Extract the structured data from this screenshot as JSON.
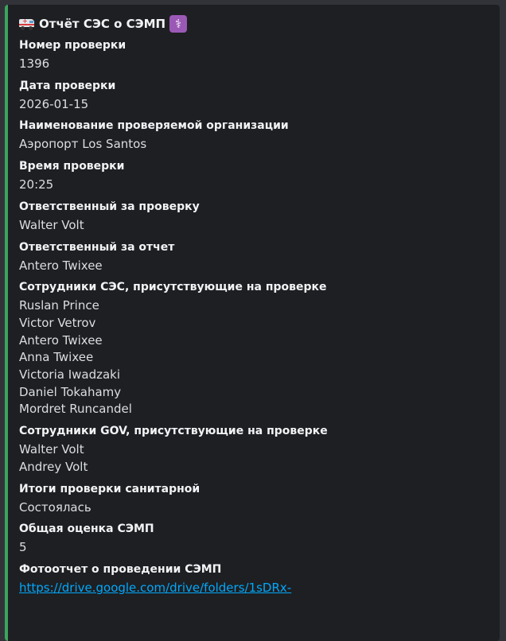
{
  "embed": {
    "title": "Отчёт СЭС о СЭМП",
    "title_icon_left": "ambulance-icon",
    "title_icon_right": "medical-symbol-icon",
    "accent_color": "#3ba55d",
    "fields": [
      {
        "name": "Номер проверки",
        "values": [
          "1396"
        ]
      },
      {
        "name": "Дата проверки",
        "values": [
          "2026-01-15"
        ]
      },
      {
        "name": "Наименование проверяемой организации",
        "values": [
          "Аэропорт Los Santos"
        ]
      },
      {
        "name": "Время проверки",
        "values": [
          "20:25"
        ]
      },
      {
        "name": "Ответственный за проверку",
        "values": [
          "Walter Volt"
        ]
      },
      {
        "name": "Ответственный за отчет",
        "values": [
          "Antero Twixee"
        ]
      },
      {
        "name": "Сотрудники СЭС, присутствующие на проверке",
        "values": [
          "Ruslan Prince",
          "Victor Vetrov",
          "Antero Twixee",
          "Anna Twixee",
          "Victoria Iwadzaki",
          "Daniel Tokahamy",
          "Mordret Runcandel"
        ]
      },
      {
        "name": "Сотрудники GOV, присутствующие на проверке",
        "values": [
          "Walter Volt",
          "Andrey Volt"
        ]
      },
      {
        "name": "Итоги проверки санитарной",
        "values": [
          "Состоялась"
        ]
      },
      {
        "name": "Общая оценка СЭМП",
        "values": [
          "5"
        ]
      },
      {
        "name": "Фотоотчет о проведении СЭМП",
        "link": "https://drive.google.com/drive/folders/1sDRx-"
      }
    ]
  }
}
